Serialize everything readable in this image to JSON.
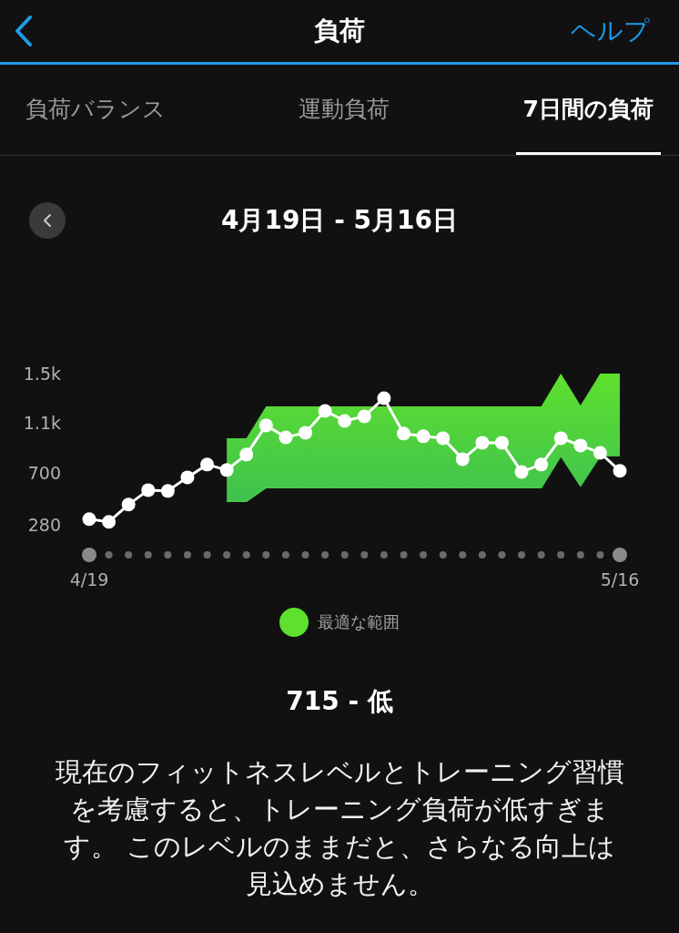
{
  "header": {
    "title": "負荷",
    "help": "ヘルプ"
  },
  "tabs": [
    {
      "label": "負荷バランス",
      "selected": false
    },
    {
      "label": "運動負荷",
      "selected": false
    },
    {
      "label": "7日間の負荷",
      "selected": true
    }
  ],
  "period": {
    "range": "4月19日 - 5月16日"
  },
  "chart": {
    "chart_data": {
      "type": "line",
      "categories": [
        "4/19",
        null,
        null,
        null,
        null,
        null,
        null,
        null,
        null,
        null,
        null,
        null,
        null,
        null,
        null,
        null,
        null,
        null,
        null,
        null,
        null,
        null,
        null,
        null,
        null,
        null,
        null,
        "5/16"
      ],
      "series": [
        {
          "type": "line",
          "marker": "circle",
          "color": "#ffffff",
          "values": [
            326,
            304,
            443,
            560,
            553,
            663,
            766,
            722,
            847,
            1082,
            986,
            1023,
            1199,
            1118,
            1155,
            1302,
            1016,
            994,
            979,
            810,
            942,
            942,
            707,
            766,
            979,
            920,
            861,
            715
          ]
        },
        {
          "name": "最適な範囲",
          "type": "area",
          "color": "#5ee02e",
          "values": [
            null,
            null,
            null,
            null,
            null,
            null,
            null,
            979,
            979,
            1236,
            1236,
            1236,
            1236,
            1236,
            1236,
            1236,
            1236,
            1236,
            1236,
            1236,
            1236,
            1236,
            1236,
            1236,
            1500,
            1243,
            1500,
            1500
          ]
        },
        {
          "type": "line",
          "color": "#45c84a",
          "values": [
            null,
            null,
            null,
            null,
            null,
            null,
            null,
            472,
            472,
            582,
            582,
            582,
            582,
            582,
            582,
            582,
            582,
            582,
            582,
            582,
            582,
            582,
            582,
            582,
            839,
            597,
            839,
            839
          ]
        }
      ],
      "ylim": [
        280,
        1500
      ],
      "yticks": [
        {
          "value": 280,
          "label": "280"
        },
        {
          "value": 700,
          "label": "700"
        },
        {
          "value": 1100,
          "label": "1.1k"
        },
        {
          "value": 1500,
          "label": "1.5k"
        }
      ]
    }
  },
  "summary": {
    "value": "715 - 低",
    "text": "現在のフィットネスレベルとトレーニング習慣を考慮すると、トレーニング負荷が低すぎます。 このレベルのままだと、さらなる向上は見込めません。"
  }
}
